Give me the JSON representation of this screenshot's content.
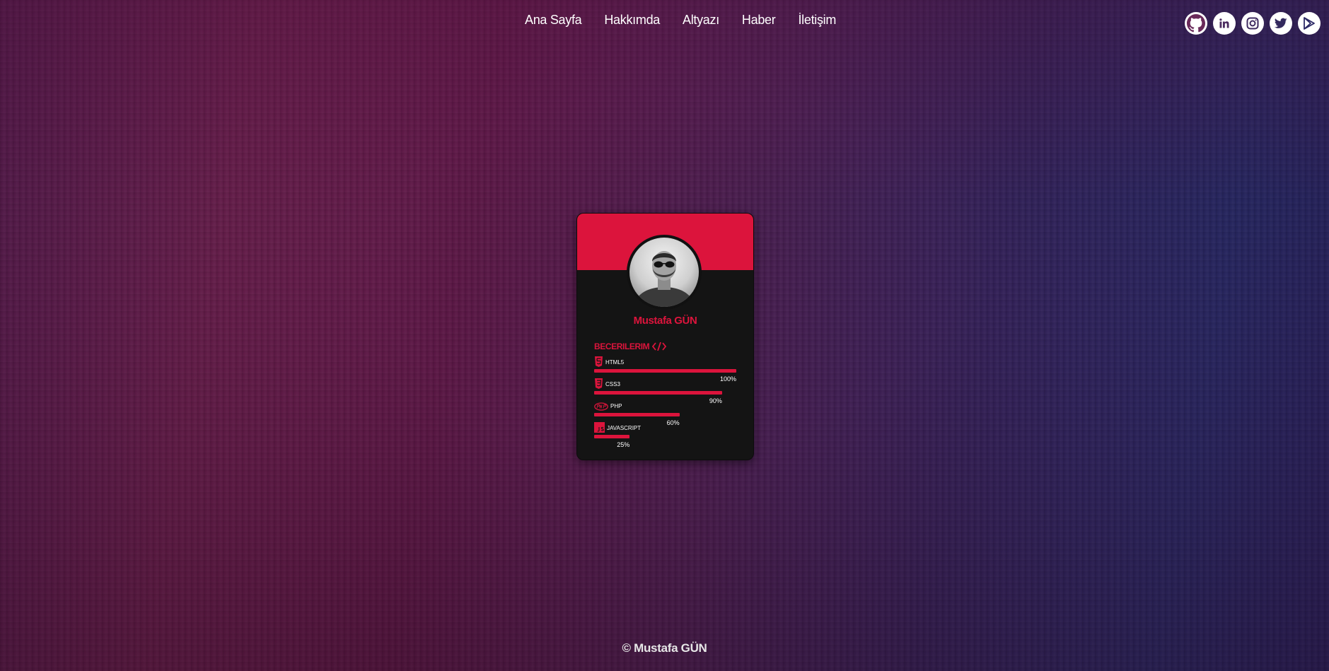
{
  "nav": {
    "items": [
      {
        "label": "Ana Sayfa"
      },
      {
        "label": "Hakkımda"
      },
      {
        "label": "Altyazı"
      },
      {
        "label": "Haber"
      },
      {
        "label": "İletişim"
      }
    ]
  },
  "social": {
    "icons": [
      "github-icon",
      "linkedin-icon",
      "instagram-icon",
      "twitter-icon",
      "google-play-icon"
    ]
  },
  "card": {
    "name": "Mustafa GÜN",
    "skills_title": "BECERILERIM",
    "skills": [
      {
        "name": "HTML5",
        "percent_label": "100%",
        "level": 1.0,
        "icon": "html5-icon"
      },
      {
        "name": "CSS3",
        "percent_label": "90%",
        "level": 0.9,
        "icon": "css3-icon"
      },
      {
        "name": "PHP",
        "percent_label": "60%",
        "level": 0.6,
        "icon": "php-icon"
      },
      {
        "name": "JAVASCRIPT",
        "percent_label": "25%",
        "level": 0.25,
        "icon": "javascript-icon"
      }
    ]
  },
  "footer": {
    "text": "© Mustafa GÜN"
  },
  "colors": {
    "accent": "#dc143c",
    "card_bg": "#141414"
  }
}
